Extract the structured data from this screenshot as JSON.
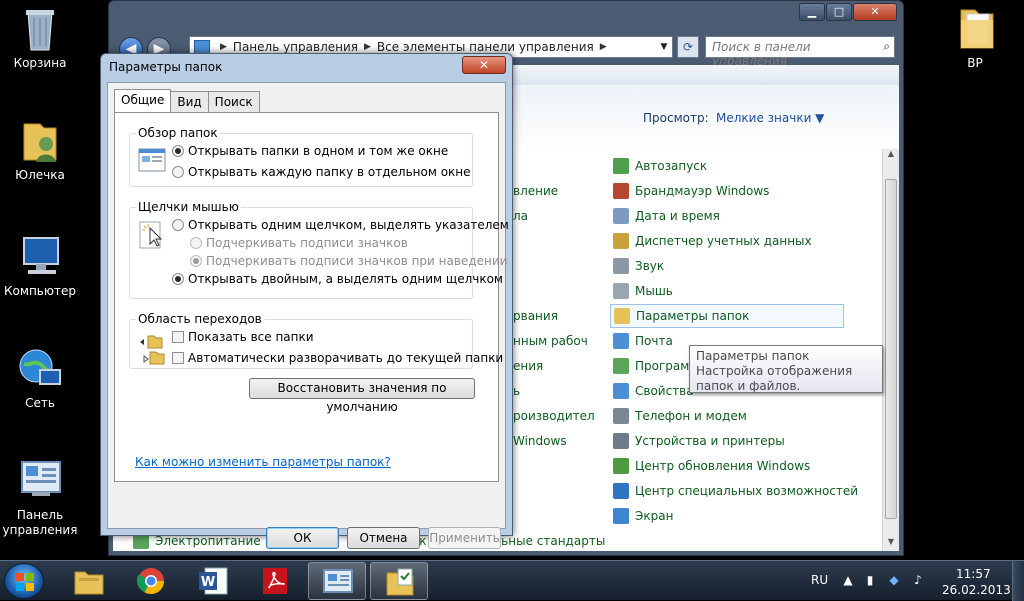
{
  "desktop": {
    "icons": [
      {
        "label": "Корзина"
      },
      {
        "label": "Юлечка"
      },
      {
        "label": "Компьютер"
      },
      {
        "label": "Сеть"
      },
      {
        "label": "Панель управления"
      },
      {
        "label": "BP"
      }
    ]
  },
  "explorer": {
    "address": {
      "crumb1": "Панель управления",
      "crumb2": "Все элементы панели управления"
    },
    "search_placeholder": "Поиск в панели управления",
    "view_label": "Просмотр:",
    "view_value": "Мелкие значки ▼",
    "items_right": [
      "Автозапуск",
      "Брандмауэр Windows",
      "Дата и время",
      "Диспетчер учетных данных",
      "Звук",
      "Мышь",
      "Параметры папок",
      "Почта",
      "Программ",
      "Свойства",
      "Телефон и модем",
      "Устройства и принтеры",
      "Центр обновления Windows",
      "Центр специальных возможностей",
      "Экран"
    ],
    "items_left_partial": [
      "вление",
      "ла",
      "рвания",
      "нным рабоч",
      "ения",
      "ь",
      "роизводител",
      "Windows"
    ],
    "bottom_items": [
      "Электропитание",
      "Язык и региональные стандарты"
    ]
  },
  "tooltip": {
    "title": "Параметры папок",
    "text": "Настройка отображения папок и файлов."
  },
  "dialog": {
    "title": "Параметры папок",
    "close": "✕",
    "tabs": [
      "Общие",
      "Вид",
      "Поиск"
    ],
    "browse": {
      "title": "Обзор папок",
      "options": [
        "Открывать папки в одном и том же окне",
        "Открывать каждую папку в отдельном окне"
      ]
    },
    "click": {
      "title": "Щелчки мышью",
      "options": [
        "Открывать одним щелчком, выделять указателем",
        "Подчеркивать подписи значков",
        "Подчеркивать подписи значков при наведении",
        "Открывать двойным, а выделять одним щелчком"
      ]
    },
    "nav": {
      "title": "Область переходов",
      "options": [
        "Показать все папки",
        "Автоматически разворачивать до текущей папки"
      ]
    },
    "restore": "Восстановить значения по умолчанию",
    "help_link": "Как можно изменить параметры папок?",
    "buttons": {
      "ok": "ОК",
      "cancel": "Отмена",
      "apply": "Применить"
    }
  },
  "taskbar": {
    "lang": "RU",
    "time": "11:57",
    "date": "26.02.2013"
  }
}
